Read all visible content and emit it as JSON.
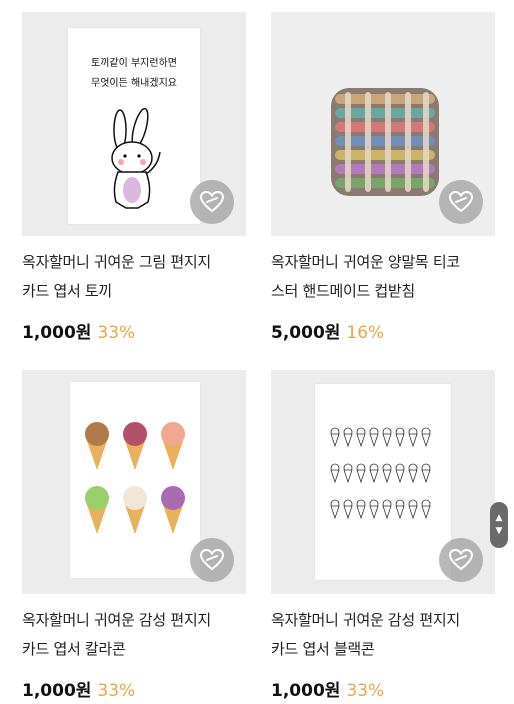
{
  "products": [
    {
      "title_line1": "옥자할머니 귀여운 그림 편지지",
      "title_line2": "카드 엽서 토끼",
      "price": "1,000",
      "currency": "원",
      "discount": "33%",
      "image": "rabbit-card-image",
      "card_text_line1": "토끼같이 부지런하면",
      "card_text_line2": "무엇이든 해내겠지요"
    },
    {
      "title_line1": "옥자할머니 귀여운 양말목 티코",
      "title_line2": "스터 핸드메이드 컵받침",
      "price": "5,000",
      "currency": "원",
      "discount": "16%",
      "image": "woven-coaster-image"
    },
    {
      "title_line1": "옥자할머니 귀여운 감성 편지지",
      "title_line2": "카드 엽서 칼라콘",
      "price": "1,000",
      "currency": "원",
      "discount": "33%",
      "image": "color-cone-card-image"
    },
    {
      "title_line1": "옥자할머니 귀여운 감성 편지지",
      "title_line2": "카드 엽서 블랙콘",
      "price": "1,000",
      "currency": "원",
      "discount": "33%",
      "image": "black-cone-card-image"
    }
  ],
  "colors": {
    "discount": "#e9a54a",
    "thumb_bg": "#ececec"
  },
  "icons": {
    "wishlist": "heart-icon",
    "scroll": "chevron-up-down-icon"
  }
}
